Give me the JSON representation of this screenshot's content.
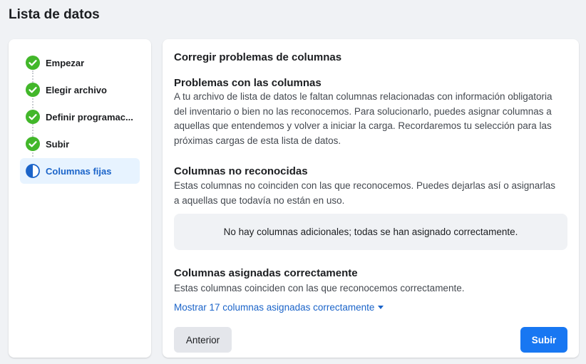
{
  "page": {
    "title": "Lista de datos"
  },
  "sidebar": {
    "steps": [
      {
        "label": "Empezar",
        "status": "complete",
        "icon": "check-circle-icon"
      },
      {
        "label": "Elegir archivo",
        "status": "complete",
        "icon": "check-circle-icon"
      },
      {
        "label": "Definir programac...",
        "status": "complete",
        "icon": "check-circle-icon"
      },
      {
        "label": "Subir",
        "status": "complete",
        "icon": "check-circle-icon"
      },
      {
        "label": "Columnas fijas",
        "status": "in-progress",
        "icon": "half-circle-icon"
      }
    ]
  },
  "main": {
    "title": "Corregir problemas de columnas",
    "problems": {
      "title": "Problemas con las columnas",
      "text": "A tu archivo de lista de datos le faltan columnas relacionadas con información obligatoria del inventario o bien no las reconocemos. Para solucionarlo, puedes asignar columnas a aquellas que entendemos y volver a iniciar la carga. Recordaremos tu selección para las próximas cargas de esta lista de datos."
    },
    "unrecognized": {
      "title": "Columnas no reconocidas",
      "text": "Estas columnas no coinciden con las que reconocemos. Puedes dejarlas así o asignarlas a aquellas que todavía no están en uso.",
      "empty_message": "No hay columnas adicionales; todas se han asignado correctamente."
    },
    "assigned": {
      "title": "Columnas asignadas correctamente",
      "text": "Estas columnas coinciden con las que reconocemos correctamente.",
      "toggle_link": "Mostrar 17 columnas asignadas correctamente"
    },
    "buttons": {
      "back": "Anterior",
      "submit": "Subir"
    }
  },
  "colors": {
    "success": "#42b72a",
    "accent": "#1877f2",
    "link": "#1b64c9",
    "active_step_bg": "#e7f3ff"
  }
}
